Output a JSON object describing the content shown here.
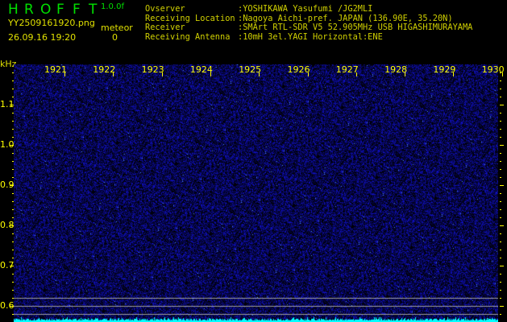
{
  "header": {
    "app_title": [
      "H",
      "R",
      "O",
      "F",
      "F",
      "T"
    ],
    "version": "1.0.0f",
    "filename": "YY2509161920.png",
    "datetime": "26.09.16 19:20",
    "meteor_label": "meteor",
    "meteor_count": "0",
    "info": [
      {
        "label": "Ovserver",
        "value": ":YOSHIKAWA Yasufumi /JG2MLI"
      },
      {
        "label": "Receiving Location",
        "value": ":Nagoya Aichi-pref. JAPAN (136.90E, 35.20N)"
      },
      {
        "label": "Receiver",
        "value": ":SMArt RTL-SDR V5 52.905MHz USB HIGASHIMURAYAMA"
      },
      {
        "label": "Receiving Antenna",
        "value": ":10mH 3el.YAGI Horizontal:ENE"
      }
    ]
  },
  "axis": {
    "unit": "kHz",
    "time_labels": [
      "1921",
      "1922",
      "1923",
      "1924",
      "1925",
      "1926",
      "1927",
      "1928",
      "1929",
      "1930"
    ],
    "freq_labels": [
      "1.1",
      "1.0",
      "0.9",
      "0.8",
      "0.7",
      "0.6"
    ]
  },
  "colors": {
    "noise": "#1010c0",
    "baseline": "#00ffff",
    "text": "#ffff00",
    "title": "#00e000"
  }
}
